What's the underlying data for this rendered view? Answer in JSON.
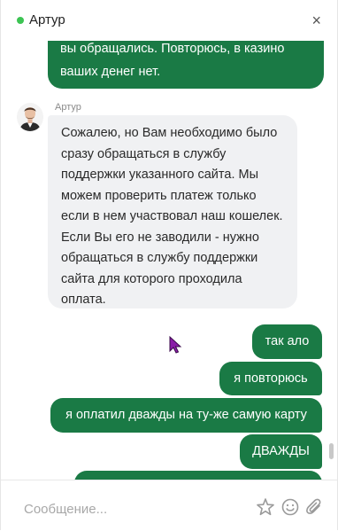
{
  "header": {
    "title": "Артур",
    "status_color": "#3cc453",
    "close_icon": "×"
  },
  "messages": {
    "previous_outgoing": "вы обращались. Повторюсь, в казино ваших денег нет.",
    "agent": {
      "name": "Артур",
      "avatar": "agent-avatar",
      "text": "Сожалею, но Вам необходимо было сразу обращаться в службу поддержки указанного сайта. Мы можем проверить платеж только если в нем участвовал наш кошелек. Если Вы его не заводили - нужно обращаться в службу поддержки сайта для которого проходила оплата."
    },
    "outgoing": [
      "так ало",
      "я повторюсь",
      "я оплатил дважды на ту-же самую карту",
      "ДВАЖДЫ",
      ""
    ]
  },
  "composer": {
    "placeholder": "Сообщение...",
    "value": "",
    "icons": [
      "star-icon",
      "emoji-icon",
      "attach-icon"
    ]
  },
  "colors": {
    "outgoing_bubble": "#1a7a45",
    "incoming_bubble": "#f0f1f3",
    "cursor": "#8a1ca8"
  }
}
